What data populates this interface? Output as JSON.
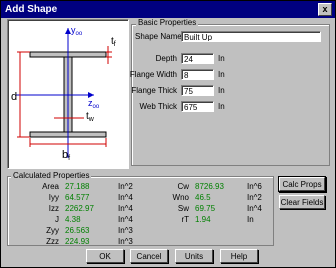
{
  "window": {
    "title": "Add Shape",
    "close_glyph": "x"
  },
  "diagram": {
    "labels": {
      "y": "y",
      "y_sub": "oo",
      "z": "z",
      "z_sub": "oo",
      "tf": "t",
      "tf_sub": "f",
      "d": "d",
      "tw": "t",
      "tw_sub": "w",
      "bf": "b",
      "bf_sub": "f"
    },
    "colors": {
      "dimension": "#d00000",
      "axis": "#0000cc"
    }
  },
  "basic": {
    "title": "Basic Properties",
    "shape_name_label": "Shape Name",
    "shape_name_value": "Built Up",
    "fields": [
      {
        "label": "Depth",
        "value": "24",
        "unit": "In"
      },
      {
        "label": "Flange Width",
        "value": "8",
        "unit": "In"
      },
      {
        "label": "Flange Thick",
        "value": "75",
        "unit": "In"
      },
      {
        "label": "Web Thick",
        "value": "675",
        "unit": "In"
      }
    ]
  },
  "calc": {
    "title": "Calculated Properties",
    "left": [
      {
        "label": "Area",
        "value": "27.188",
        "unit": "In^2"
      },
      {
        "label": "Iyy",
        "value": "64.577",
        "unit": "In^4"
      },
      {
        "label": "Izz",
        "value": "2262.97",
        "unit": "In^4"
      },
      {
        "label": "J",
        "value": "4.38",
        "unit": "In^4"
      },
      {
        "label": "Zyy",
        "value": "26.563",
        "unit": "In^3"
      },
      {
        "label": "Zzz",
        "value": "224.93",
        "unit": "In^3"
      }
    ],
    "right": [
      {
        "label": "Cw",
        "value": "8726.93",
        "unit": "In^6"
      },
      {
        "label": "Wno",
        "value": "46.5",
        "unit": "In^2"
      },
      {
        "label": "Sw",
        "value": "69.75",
        "unit": "In^4"
      },
      {
        "label": "rT",
        "value": "1.94",
        "unit": "In"
      }
    ]
  },
  "buttons": {
    "calc_props": "Calc Props",
    "clear_fields": "Clear Fields",
    "ok": "OK",
    "cancel": "Cancel",
    "units": "Units",
    "help": "Help"
  }
}
